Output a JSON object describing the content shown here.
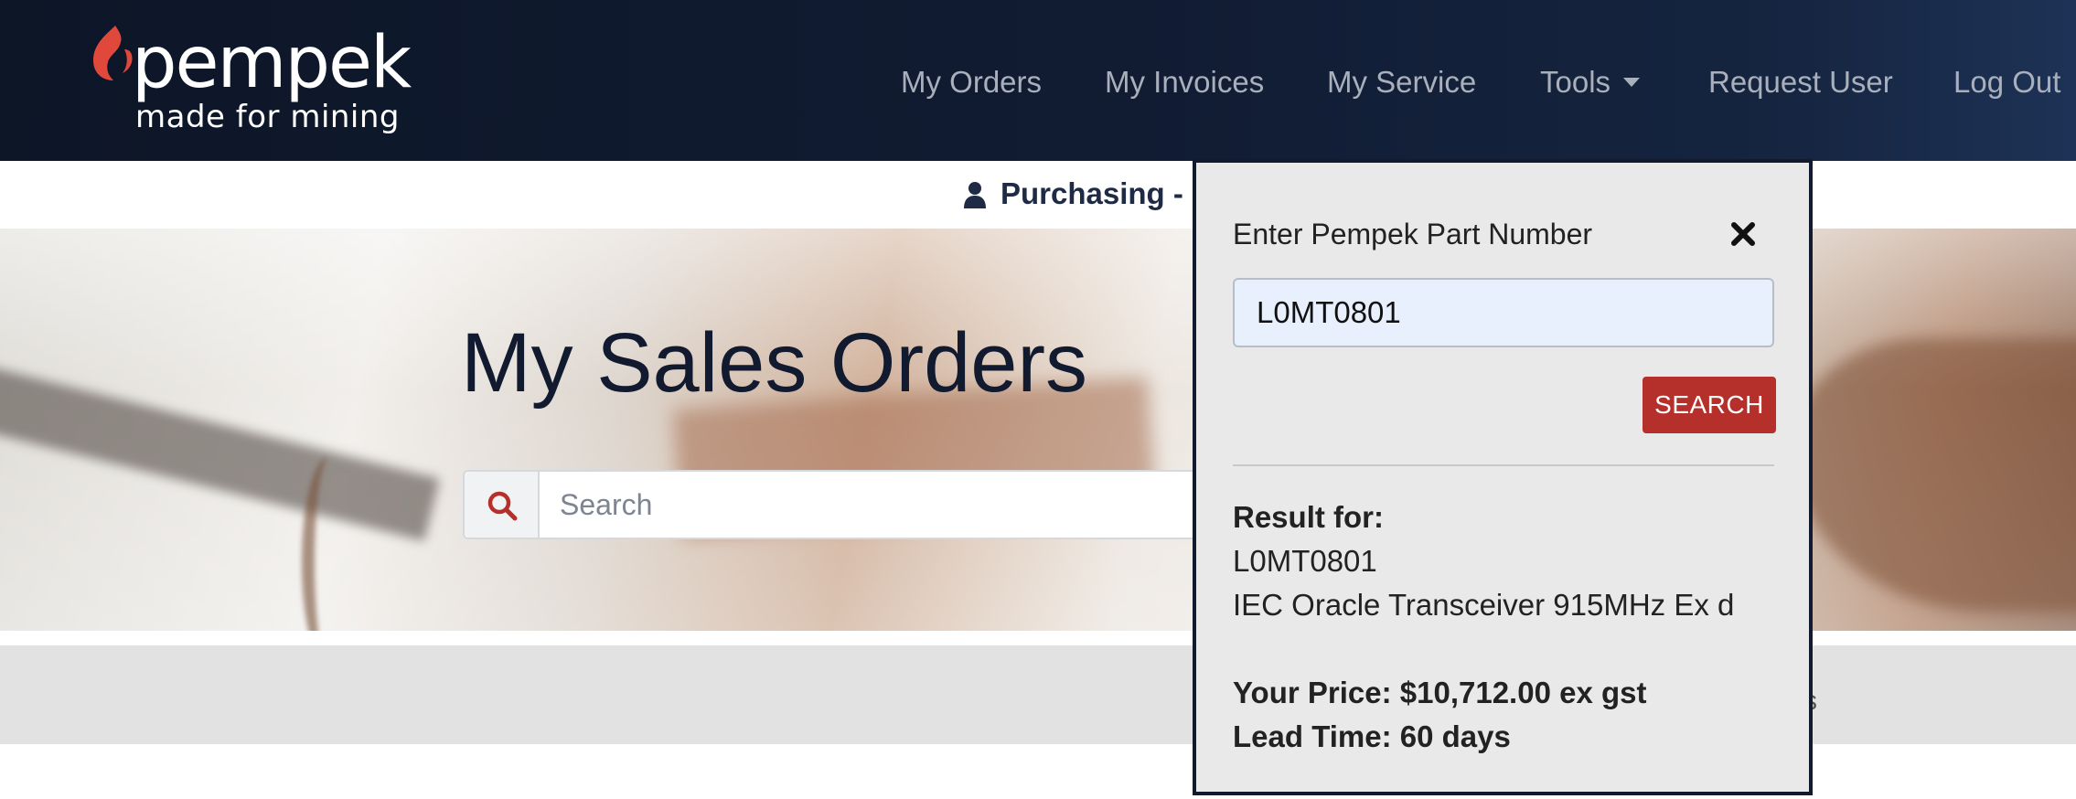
{
  "brand": {
    "name": "pempek",
    "tagline": "made for mining",
    "accent_color": "#e0483c"
  },
  "nav": {
    "items": [
      {
        "label": "My Orders"
      },
      {
        "label": "My Invoices"
      },
      {
        "label": "My Service"
      },
      {
        "label": "Tools",
        "has_dropdown": true
      },
      {
        "label": "Request User"
      },
      {
        "label": "Log Out"
      }
    ]
  },
  "user": {
    "icon": "user-icon",
    "label": "Purchasing - C"
  },
  "hero": {
    "title": "My Sales Orders",
    "search_placeholder": "Search",
    "search_value": "",
    "search_icon": "search-icon"
  },
  "grey_band": {
    "partial_text": "s"
  },
  "part_lookup": {
    "label": "Enter Pempek Part Number",
    "close_icon": "close-icon",
    "input_value": "L0MT0801",
    "button_label": "SEARCH",
    "result_heading": "Result for:",
    "result_part": "L0MT0801",
    "result_description": "IEC Oracle Transceiver 915MHz Ex d",
    "price_line": "Your Price: $10,712.00 ex gst",
    "lead_time_line": "Lead Time: 60 days",
    "button_color": "#b5302a"
  }
}
